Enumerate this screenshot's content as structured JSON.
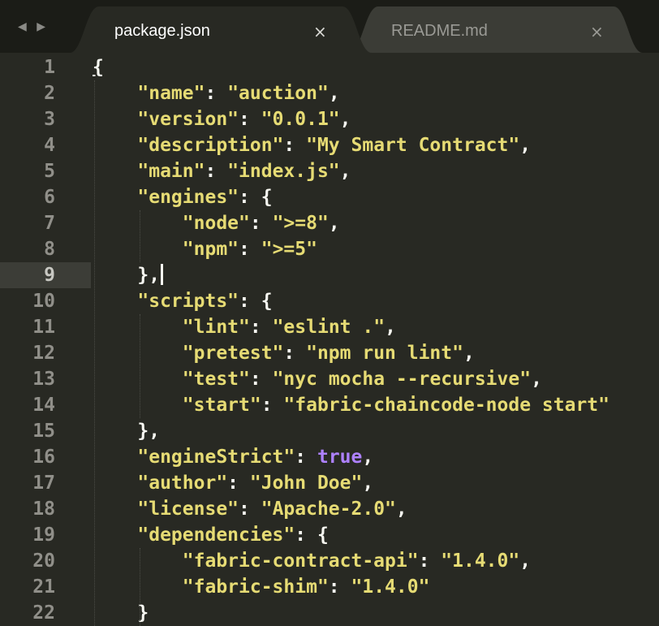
{
  "tabs": [
    {
      "label": "package.json",
      "close": "×",
      "active": true
    },
    {
      "label": "README.md",
      "close": "×",
      "active": false
    }
  ],
  "nav_arrows": "◀ ▶",
  "icons": {
    "nav": "nav-arrows-icon",
    "close": "close-icon"
  },
  "colors": {
    "background": "#282923",
    "tabbar": "#1b1c17",
    "string": "#e6db74",
    "boolean": "#ae81ff",
    "text": "#f8f8f2"
  },
  "current_line": 9,
  "lines": [
    {
      "n": "1",
      "text": "{"
    },
    {
      "n": "2",
      "text": "    \"name\": \"auction\","
    },
    {
      "n": "3",
      "text": "    \"version\": \"0.0.1\","
    },
    {
      "n": "4",
      "text": "    \"description\": \"My Smart Contract\","
    },
    {
      "n": "5",
      "text": "    \"main\": \"index.js\","
    },
    {
      "n": "6",
      "text": "    \"engines\": {"
    },
    {
      "n": "7",
      "text": "        \"node\": \">=8\","
    },
    {
      "n": "8",
      "text": "        \"npm\": \">=5\""
    },
    {
      "n": "9",
      "text": "    },"
    },
    {
      "n": "10",
      "text": "    \"scripts\": {"
    },
    {
      "n": "11",
      "text": "        \"lint\": \"eslint .\","
    },
    {
      "n": "12",
      "text": "        \"pretest\": \"npm run lint\","
    },
    {
      "n": "13",
      "text": "        \"test\": \"nyc mocha --recursive\","
    },
    {
      "n": "14",
      "text": "        \"start\": \"fabric-chaincode-node start\""
    },
    {
      "n": "15",
      "text": "    },"
    },
    {
      "n": "16",
      "text": "    \"engineStrict\": true,"
    },
    {
      "n": "17",
      "text": "    \"author\": \"John Doe\","
    },
    {
      "n": "18",
      "text": "    \"license\": \"Apache-2.0\","
    },
    {
      "n": "19",
      "text": "    \"dependencies\": {"
    },
    {
      "n": "20",
      "text": "        \"fabric-contract-api\": \"1.4.0\","
    },
    {
      "n": "21",
      "text": "        \"fabric-shim\": \"1.4.0\""
    },
    {
      "n": "22",
      "text": "    }"
    }
  ]
}
